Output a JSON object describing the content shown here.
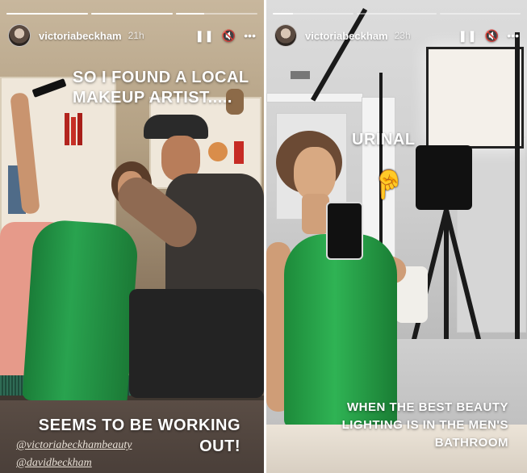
{
  "stories": [
    {
      "username": "victoriabeckham",
      "time": "21h",
      "progress": [
        1,
        1,
        0.35
      ],
      "caption_top": "SO I FOUND A LOCAL MAKEUP ARTIST.....",
      "caption_bottom": "SEEMS TO BE WORKING OUT!",
      "mentions": [
        "@victoriabeckhambeauty",
        "@davidbeckham"
      ]
    },
    {
      "username": "victoriabeckham",
      "time": "23h",
      "progress": [
        0.25,
        0,
        0
      ],
      "label": "URINAL",
      "pointer_icon": "pointing-down-hand-icon",
      "caption_bottom": "WHEN THE BEST BEAUTY LIGHTING IS IN THE MEN'S BATHROOM"
    }
  ],
  "controls": {
    "pause_icon": "pause-icon",
    "mute_icon": "mute-icon",
    "more_icon": "more-icon"
  },
  "colors": {
    "dress_green": "#29a34f",
    "sofa_pink": "#e69a8a",
    "overlay_text": "#ffffff"
  }
}
